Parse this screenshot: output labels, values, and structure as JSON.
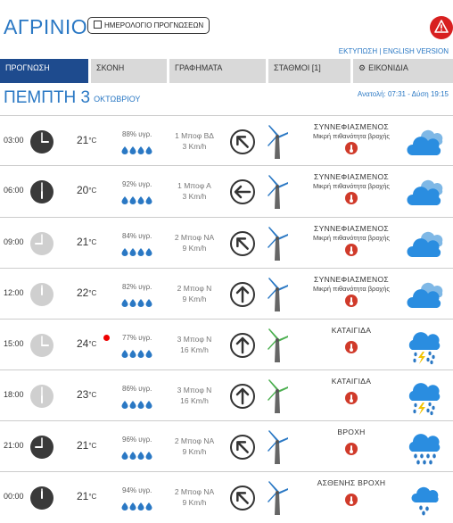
{
  "header": {
    "city": "ΑΓΡΙΝΙΟ",
    "calendar_button": "ΗΜΕΡΟΛΟΓΙΟ ΠΡΟΓΝΩΣΕΩΝ",
    "links": "ΕΚΤΥΠΩΣΗ | ENGLISH VERSION"
  },
  "tabs": [
    {
      "label": "ΠΡΟΓΝΩΣΗ",
      "active": true
    },
    {
      "label": "ΣΚΟΝΗ",
      "active": false
    },
    {
      "label": "ΓΡΑΦΗΜΑΤΑ",
      "active": false
    },
    {
      "label": "ΣΤΑΘΜΟΙ [1]",
      "active": false
    },
    {
      "label": "ΕΙΚΟΝΙΔΙΑ",
      "active": false
    }
  ],
  "day": {
    "title": "ΠΕΜΠΤΗ 3",
    "month": "ΟΚΤΩΒΡΙΟΥ",
    "sun": "Ανατολή: 07:31  -  Δύση 19:15"
  },
  "rows": [
    {
      "time": "03:00",
      "night": true,
      "temp": "21",
      "unit": "°C",
      "alert": false,
      "humidity": "88% υγρ.",
      "drops": 4,
      "wind_speed": "1 Μποφ ΒΔ",
      "wind_kmh": "3 Km/h",
      "wind_dir_deg": -45,
      "turbine_color": "#2a78c4",
      "cond": "ΣΥΝΝΕΦΙΑΣΜΕΝΟΣ",
      "subcond": "Μικρή πιθανότητα βροχής",
      "icon": "cloudy-icon"
    },
    {
      "time": "06:00",
      "night": true,
      "temp": "20",
      "unit": "°C",
      "alert": false,
      "humidity": "92% υγρ.",
      "drops": 4,
      "wind_speed": "1 Μποφ Α",
      "wind_kmh": "3 Km/h",
      "wind_dir_deg": -90,
      "turbine_color": "#2a78c4",
      "cond": "ΣΥΝΝΕΦΙΑΣΜΕΝΟΣ",
      "subcond": "Μικρή πιθανότητα βροχής",
      "icon": "cloudy-icon"
    },
    {
      "time": "09:00",
      "night": false,
      "temp": "21",
      "unit": "°C",
      "alert": false,
      "humidity": "84% υγρ.",
      "drops": 4,
      "wind_speed": "2 Μποφ ΝΑ",
      "wind_kmh": "9 Km/h",
      "wind_dir_deg": -45,
      "turbine_color": "#2a78c4",
      "cond": "ΣΥΝΝΕΦΙΑΣΜΕΝΟΣ",
      "subcond": "Μικρή πιθανότητα βροχής",
      "icon": "cloudy-icon"
    },
    {
      "time": "12:00",
      "night": false,
      "temp": "22",
      "unit": "°C",
      "alert": false,
      "humidity": "82% υγρ.",
      "drops": 4,
      "wind_speed": "2 Μποφ Ν",
      "wind_kmh": "9 Km/h",
      "wind_dir_deg": 0,
      "turbine_color": "#2a78c4",
      "cond": "ΣΥΝΝΕΦΙΑΣΜΕΝΟΣ",
      "subcond": "Μικρή πιθανότητα βροχής",
      "icon": "cloudy-icon"
    },
    {
      "time": "15:00",
      "night": false,
      "temp": "24",
      "unit": "°C",
      "alert": true,
      "humidity": "77% υγρ.",
      "drops": 4,
      "wind_speed": "3 Μποφ Ν",
      "wind_kmh": "16 Km/h",
      "wind_dir_deg": 0,
      "turbine_color": "#4caf50",
      "cond": "ΚΑΤΑΙΓΙΔΑ",
      "subcond": "",
      "icon": "thunderstorm-icon"
    },
    {
      "time": "18:00",
      "night": false,
      "temp": "23",
      "unit": "°C",
      "alert": false,
      "humidity": "86% υγρ.",
      "drops": 4,
      "wind_speed": "3 Μποφ Ν",
      "wind_kmh": "16 Km/h",
      "wind_dir_deg": 0,
      "turbine_color": "#4caf50",
      "cond": "ΚΑΤΑΙΓΙΔΑ",
      "subcond": "",
      "icon": "thunderstorm-icon"
    },
    {
      "time": "21:00",
      "night": true,
      "temp": "21",
      "unit": "°C",
      "alert": false,
      "humidity": "96% υγρ.",
      "drops": 4,
      "wind_speed": "2 Μποφ ΝΑ",
      "wind_kmh": "9 Km/h",
      "wind_dir_deg": -45,
      "turbine_color": "#2a78c4",
      "cond": "ΒΡΟΧΗ",
      "subcond": "",
      "icon": "rain-icon"
    },
    {
      "time": "00:00",
      "night": true,
      "temp": "21",
      "unit": "°C",
      "alert": false,
      "humidity": "94% υγρ.",
      "drops": 4,
      "wind_speed": "2 Μποφ ΝΑ",
      "wind_kmh": "9 Km/h",
      "wind_dir_deg": -45,
      "turbine_color": "#2a78c4",
      "cond": "ΑΣΘΕΝΗΣ ΒΡΟΧΗ",
      "subcond": "",
      "icon": "light-rain-icon"
    }
  ]
}
